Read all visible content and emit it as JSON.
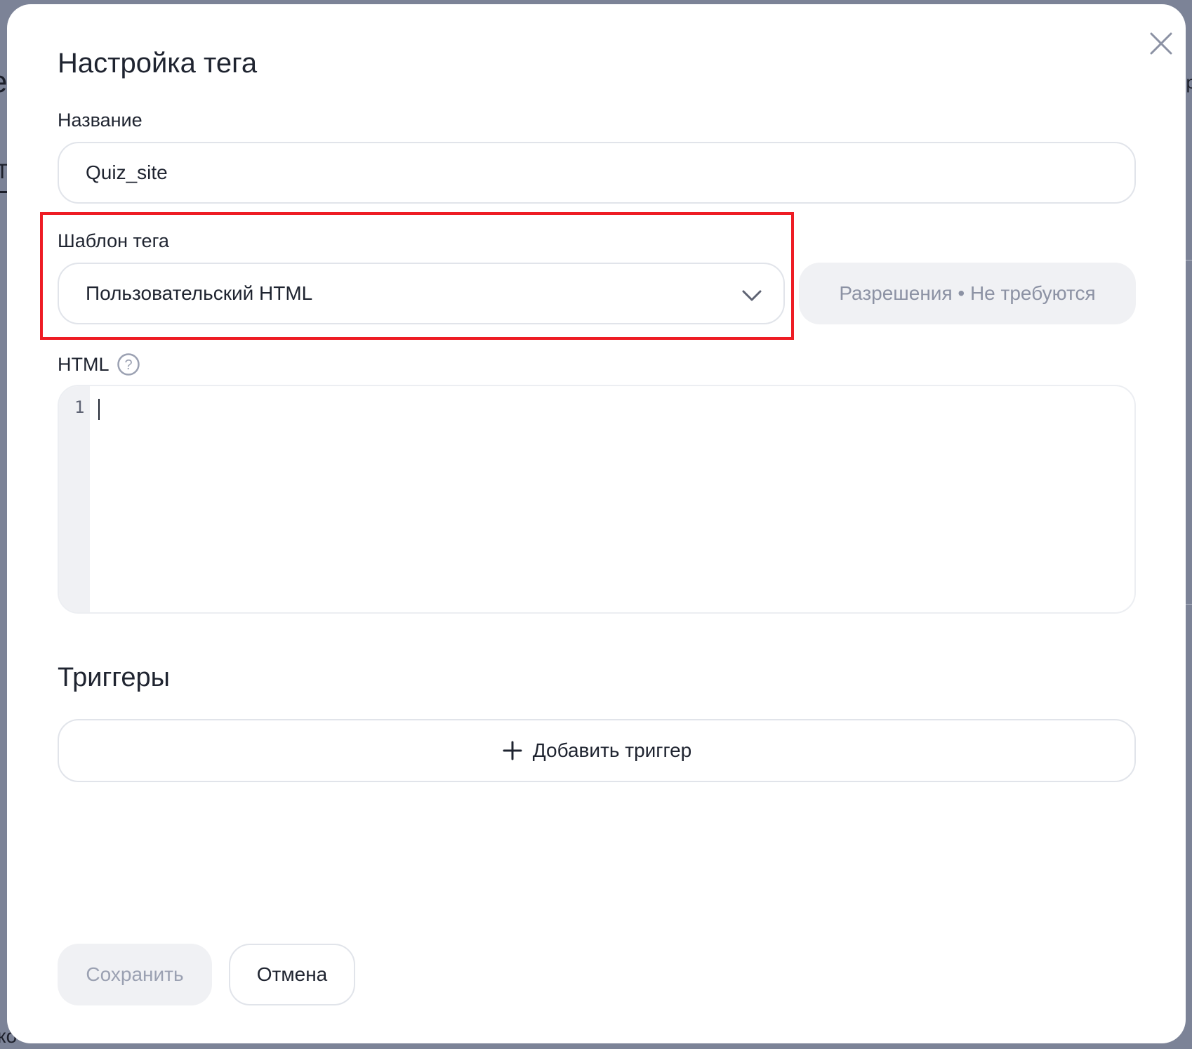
{
  "background": {
    "fragment_a": "е",
    "fragment_b": "Т",
    "fragment_c": "р",
    "fragment_d": "ко"
  },
  "dialog": {
    "title": "Настройка тега",
    "close_icon": "close-icon"
  },
  "name": {
    "label": "Название",
    "value": "Quiz_site"
  },
  "template": {
    "label": "Шаблон тега",
    "selected": "Пользовательский HTML",
    "icon": "chevron-down-icon"
  },
  "permissions": {
    "label": "Разрешения • Не требуются"
  },
  "html_editor": {
    "label": "HTML",
    "help_icon": "question-circle-icon",
    "line_numbers": [
      "1"
    ]
  },
  "triggers": {
    "title": "Триггеры",
    "add_label": "Добавить триггер",
    "add_icon": "plus-icon"
  },
  "footer": {
    "save_label": "Сохранить",
    "cancel_label": "Отмена"
  },
  "colors": {
    "highlight": "#ee1c24",
    "text": "#1f2430",
    "muted": "#8c92a4",
    "disabled_bg": "#f0f1f4",
    "overlay": "#7c8397"
  }
}
